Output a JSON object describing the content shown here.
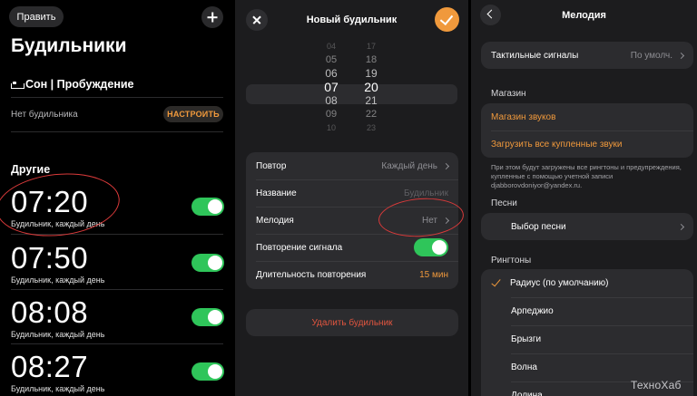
{
  "panel1": {
    "edit_label": "Править",
    "title": "Будильники",
    "sleep_section": "Сон | Пробуждение",
    "no_alarm": "Нет будильника",
    "setup_label": "НАСТРОИТЬ",
    "others_label": "Другие",
    "alarms": [
      {
        "time": "07:20",
        "sub": "Будильник, каждый день",
        "enabled": true
      },
      {
        "time": "07:50",
        "sub": "Будильник, каждый день",
        "enabled": true
      },
      {
        "time": "08:08",
        "sub": "Будильник, каждый день",
        "enabled": true
      },
      {
        "time": "08:27",
        "sub": "Будильник, каждый день",
        "enabled": true
      }
    ]
  },
  "panel2": {
    "title": "Новый будильник",
    "picker": {
      "hours": [
        "04",
        "05",
        "06",
        "07",
        "08",
        "09",
        "10"
      ],
      "minutes": [
        "17",
        "18",
        "19",
        "20",
        "21",
        "22",
        "23"
      ],
      "selected_hour": "07",
      "selected_minute": "20"
    },
    "rows": {
      "repeat_label": "Повтор",
      "repeat_value": "Каждый день",
      "name_label": "Название",
      "name_placeholder": "Будильник",
      "melody_label": "Мелодия",
      "melody_value": "Нет",
      "snooze_label": "Повторение сигнала",
      "snooze_enabled": true,
      "duration_label": "Длительность повторения",
      "duration_value": "15 мин"
    },
    "delete_label": "Удалить будильник"
  },
  "panel3": {
    "title": "Мелодия",
    "haptics_label": "Тактильные сигналы",
    "haptics_value": "По умолч.",
    "store_section": "Магазин",
    "store_items": [
      "Магазин звуков",
      "Загрузить все купленные звуки"
    ],
    "note": "При этом будут загружены все рингтоны и предупреждения, купленные с помощью учетной записи djabborovdoniyor@yandex.ru.",
    "songs_section": "Песни",
    "pick_song": "Выбор песни",
    "ringtones_section": "Рингтоны",
    "ringtones": [
      "Радиус (по умолчанию)",
      "Арпеджио",
      "Брызги",
      "Волна",
      "Долина"
    ],
    "selected_ringtone": 0
  },
  "watermark": "ТехноХаб",
  "colors": {
    "accent": "#f0993c",
    "toggle_on": "#2fc55a",
    "destructive": "#e0553f",
    "annotation": "#d93a3a"
  }
}
